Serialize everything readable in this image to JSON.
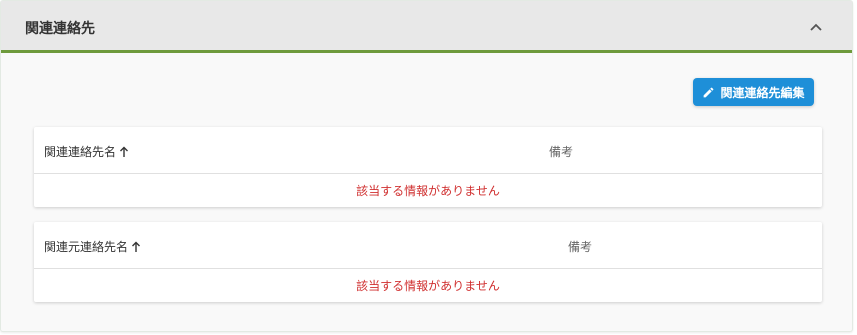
{
  "panel": {
    "title": "関連連絡先",
    "collapse_icon": "chevron-up-icon"
  },
  "toolbar": {
    "edit_label": "関連連絡先編集",
    "edit_icon": "pencil-icon",
    "accent_color": "#1e8fd8"
  },
  "tables": [
    {
      "columns": [
        "関連連絡先名",
        "備考"
      ],
      "sort_icon": "arrow-up-icon",
      "empty_message": "該当する情報がありません"
    },
    {
      "columns": [
        "関連元連絡先名",
        "備考"
      ],
      "sort_icon": "arrow-up-icon",
      "empty_message": "該当する情報がありません"
    }
  ],
  "colors": {
    "header_border": "#6e9a3c",
    "empty_text": "#d03030"
  }
}
